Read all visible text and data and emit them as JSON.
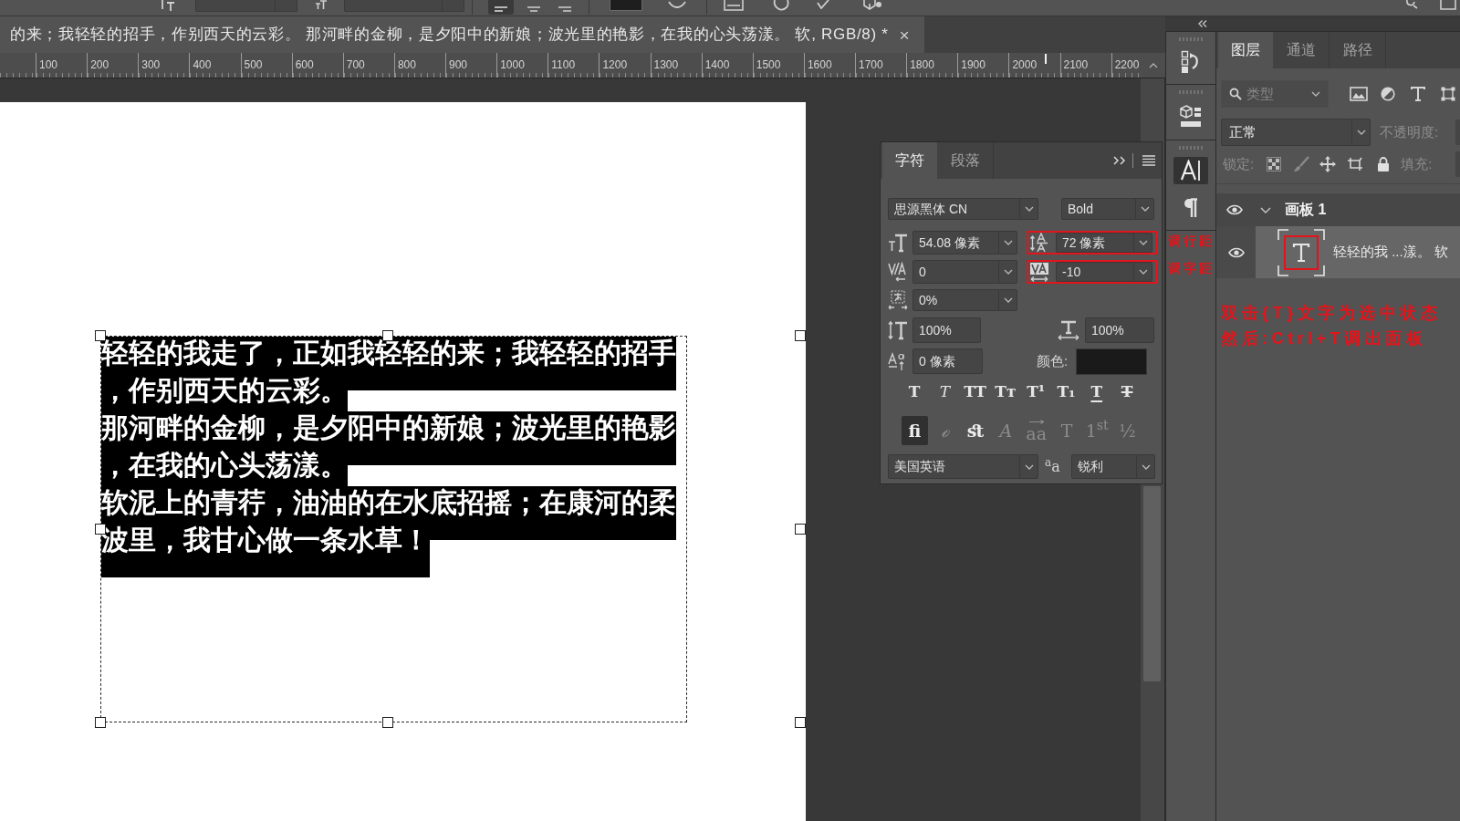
{
  "document_tab": {
    "title": "的来；我轻轻的招手，作别西天的云彩。 那河畔的金柳，是夕阳中的新娘；波光里的艳影，在我的心头荡漾。 软, RGB/8) *",
    "close": "×",
    "selected": true
  },
  "ruler": {
    "labels": [
      "100",
      "200",
      "300",
      "400",
      "500",
      "600",
      "700",
      "800",
      "900",
      "1000",
      "1100",
      "1200",
      "1300",
      "1400",
      "1500",
      "1600",
      "1700",
      "1800",
      "1900",
      "2000",
      "2100",
      "2200"
    ]
  },
  "artboard": {
    "text_selected": true,
    "text_lines": [
      "轻轻的我走了，正如我轻轻的来；我轻轻的招手",
      "，作别西天的云彩。",
      "那河畔的金柳，是夕阳中的新娘；波光里的艳影",
      "，在我的心头荡漾。",
      "软泥上的青荇，油油的在水底招摇；在康河的柔",
      "波里，我甘心做一条水草！"
    ]
  },
  "character_panel": {
    "tabs": [
      {
        "label": "字符",
        "selected": true
      },
      {
        "label": "段落",
        "selected": false
      }
    ],
    "font_family": "思源黑体 CN",
    "font_style": "Bold",
    "font_size": "54.08 像素",
    "leading": {
      "value": "72 像素",
      "annotated": true
    },
    "kerning": "0",
    "tracking": {
      "value": "-10",
      "annotated": true
    },
    "tsume": "0%",
    "vertical_scale": "100%",
    "horizontal_scale": "100%",
    "baseline_shift": "0 像素",
    "color_label": "颜色:",
    "color_swatch": {
      "color": "#1a1a1a"
    },
    "style_buttons": [
      {
        "label": "T",
        "kind": "faux_bold"
      },
      {
        "label": "T",
        "kind": "faux_italic"
      },
      {
        "label": "TT",
        "kind": "all_caps"
      },
      {
        "label": "Tᴛ",
        "kind": "small_caps"
      },
      {
        "label": "T¹",
        "kind": "superscript"
      },
      {
        "label": "T₁",
        "kind": "subscript"
      },
      {
        "label": "T",
        "kind": "underline"
      },
      {
        "label": "T",
        "kind": "strikethrough"
      }
    ],
    "opentype_buttons": [
      {
        "label": "fi",
        "kind": "ligatures",
        "selected": true,
        "disabled": false
      },
      {
        "label": "ℴ",
        "kind": "contextual",
        "selected": false,
        "disabled": true
      },
      {
        "label": "ﬆ",
        "kind": "discretionary",
        "selected": false,
        "disabled": false
      },
      {
        "label": "A",
        "kind": "swash",
        "selected": false,
        "disabled": true
      },
      {
        "label": "aa",
        "kind": "stylistic",
        "selected": false,
        "disabled": true
      },
      {
        "label": "T",
        "kind": "titling",
        "selected": false,
        "disabled": true
      },
      {
        "label": "1$^{st}$",
        "kind": "ordinals",
        "selected": false,
        "disabled": true
      },
      {
        "label": "½",
        "kind": "fractions",
        "selected": false,
        "disabled": true
      }
    ],
    "language": "美国英语",
    "antialias_label": "$^{a}$a",
    "antialias": "锐利"
  },
  "toolstrip": {
    "items": [
      {
        "kind": "history",
        "selected": false
      },
      {
        "kind": "model",
        "selected": false
      },
      {
        "kind": "character",
        "selected": true
      },
      {
        "kind": "paragraph",
        "selected": false
      }
    ],
    "notes": [
      "调行距",
      "调字距"
    ]
  },
  "layers_panel": {
    "tabs": [
      {
        "label": "图层",
        "selected": true
      },
      {
        "label": "通道",
        "selected": false
      },
      {
        "label": "路径",
        "selected": false
      }
    ],
    "filter_kind": "类型",
    "blend_mode": "正常",
    "opacity_label": "不透明度:",
    "lock_label": "锁定:",
    "fill_label": "填充:",
    "layers": [
      {
        "kind": "artboard",
        "name": "画板 1",
        "visible": true,
        "expanded": true,
        "selected": false,
        "children": [
          {
            "kind": "text",
            "name": "轻轻的我 ...漾。 软",
            "visible": true,
            "selected": true,
            "annotated": true
          }
        ]
      }
    ],
    "instructions": [
      "双击{T}文字为选中状态",
      "然后:Ctrl+T调出面板"
    ]
  }
}
